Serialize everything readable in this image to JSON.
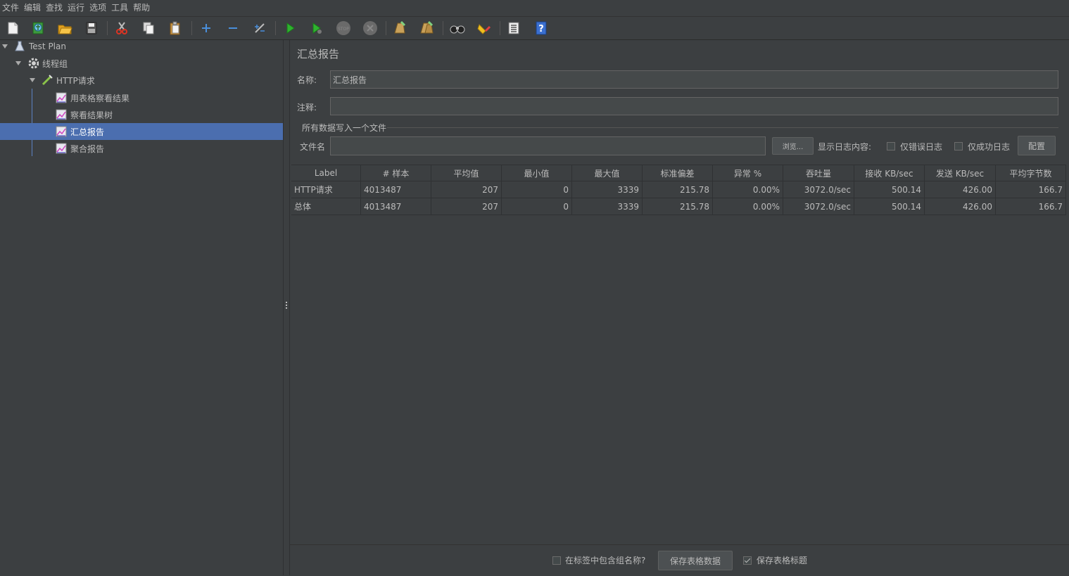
{
  "menu": [
    "文件",
    "编辑",
    "查找",
    "运行",
    "选项",
    "工具",
    "帮助"
  ],
  "toolbar": {
    "icons": [
      "new-icon",
      "templates-icon",
      "open-icon",
      "save-icon",
      "cut-icon",
      "copy-icon",
      "paste-icon",
      "expand-icon",
      "collapse-icon",
      "toggle-icon",
      "start-icon",
      "start-no-pause-icon",
      "stop-icon",
      "shutdown-icon",
      "clear-icon",
      "clear-all-icon",
      "search-icon",
      "reset-search-icon",
      "function-helper-icon",
      "help-icon"
    ]
  },
  "tree": {
    "items": [
      {
        "label": "Test Plan",
        "icon": "test-plan-icon"
      },
      {
        "label": "线程组",
        "icon": "gear-icon"
      },
      {
        "label": "HTTP请求",
        "icon": "sampler-icon"
      },
      {
        "label": "用表格察看结果",
        "icon": "listener-icon"
      },
      {
        "label": "察看结果树",
        "icon": "listener-icon"
      },
      {
        "label": "汇总报告",
        "icon": "listener-icon"
      },
      {
        "label": "聚合报告",
        "icon": "listener-icon"
      }
    ]
  },
  "panel": {
    "title": "汇总报告",
    "name_label": "名称:",
    "name_value": "汇总报告",
    "comment_label": "注释:",
    "comment_value": "",
    "group_title": "所有数据写入一个文件",
    "filename_label": "文件名",
    "filename_value": "",
    "browse_button": "浏览...",
    "log_label": "显示日志内容:",
    "errors_only": "仅错误日志",
    "success_only": "仅成功日志",
    "configure_button": "配置"
  },
  "table": {
    "headers": [
      "Label",
      "# 样本",
      "平均值",
      "最小值",
      "最大值",
      "标准偏差",
      "异常 %",
      "吞吐量",
      "接收 KB/sec",
      "发送 KB/sec",
      "平均字节数"
    ],
    "rows": [
      [
        "HTTP请求",
        "4013487",
        "207",
        "0",
        "3339",
        "215.78",
        "0.00%",
        "3072.0/sec",
        "500.14",
        "426.00",
        "166.7"
      ],
      [
        "总体",
        "4013487",
        "207",
        "0",
        "3339",
        "215.78",
        "0.00%",
        "3072.0/sec",
        "500.14",
        "426.00",
        "166.7"
      ]
    ]
  },
  "bottom": {
    "include_group_label": "在标签中包含组名称?",
    "include_group_checked": false,
    "save_table_button": "保存表格数据",
    "save_header_label": "保存表格标题",
    "save_header_checked": true
  },
  "colors": {
    "background": "#3c3f41",
    "selection": "#4b6eaf",
    "text": "#bbbbbb"
  }
}
